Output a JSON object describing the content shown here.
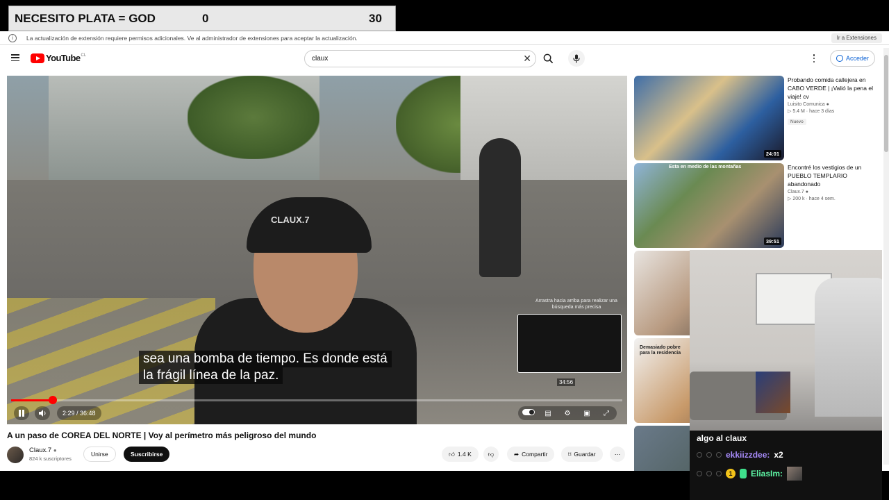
{
  "overlay": {
    "title": "NECESITO PLATA = GOD",
    "value_a": "0",
    "value_b": "30"
  },
  "notice": {
    "text": "La actualización de extensión requiere permisos adicionales. Ve al administrador de extensiones para aceptar la actualización.",
    "button": "Ir a Extensiones",
    "icon": "info-icon"
  },
  "header": {
    "logo_text": "YouTube",
    "logo_country": "CL",
    "search_value": "claux",
    "signin_label": "Acceder"
  },
  "player": {
    "subtitle_line1": "sea una bomba de tiempo. Es donde está",
    "subtitle_line2": "la frágil línea de la paz.",
    "cap_text": "CLAUX.7",
    "hint": "Arrastra hacia arriba para realizar una búsqueda más precisa",
    "preview_time": "34:56",
    "time": "2:29 / 36:48",
    "progress": 0.0677,
    "accent": "#ff0000"
  },
  "video": {
    "title": "A un paso de COREA DEL NORTE | Voy al perímetro más peligroso del mundo",
    "channel": "Claux.7",
    "subscribers": "824 k suscriptores",
    "join": "Unirse",
    "subscribe": "Suscribirse",
    "likes": "1.4 K",
    "share": "Compartir",
    "save": "Guardar"
  },
  "recommendations": [
    {
      "title": "Probando comida callejera en CABO VERDE | ¡Valió la pena el viaje! cv",
      "channel": "Luisito Comunica",
      "stats": "5.4 M · hace 3 días",
      "badge": "Nuevo",
      "duration": "24:01"
    },
    {
      "title": "Encontré los vestigios de un PUEBLO TEMPLARIO abandonado",
      "channel": "Claux.7",
      "stats": "200 k · hace 4 sem.",
      "badge": "",
      "duration": "39:51",
      "thumb_caption": "Esta en medio de las montañas"
    },
    {
      "thumb_caption": "Demasiado pobre para la residencia"
    }
  ],
  "chat": {
    "line0": "algo al claux",
    "row1_user": "ekkiizzdee:",
    "row1_msg": "x2",
    "row2_user": "EliasIm:",
    "row2_badge": "1"
  }
}
